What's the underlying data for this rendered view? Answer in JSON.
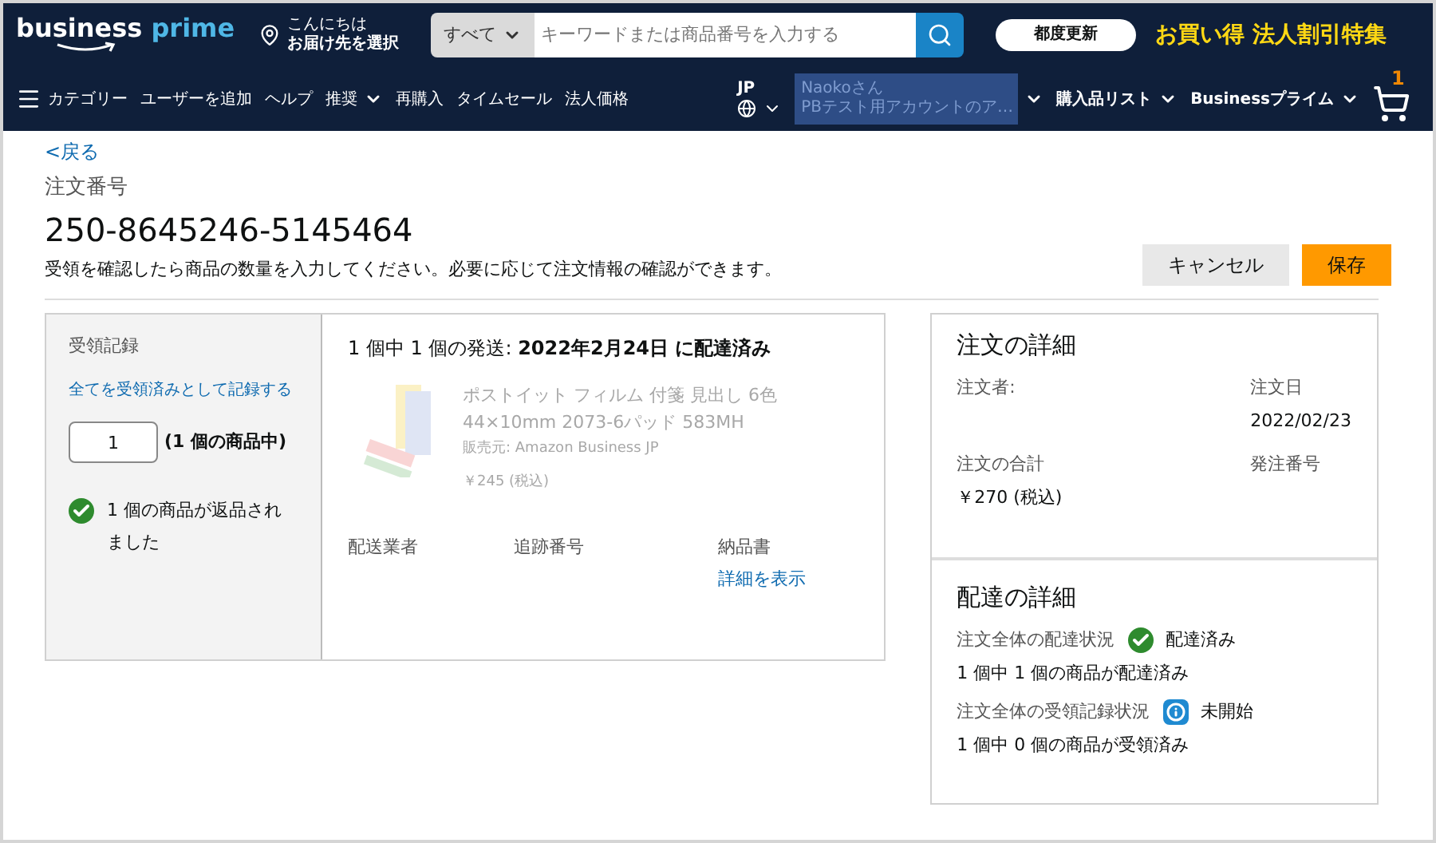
{
  "header": {
    "logo": {
      "word_1": "business",
      "word_2": "prime"
    },
    "location": {
      "greeting": "こんにちは",
      "label": "お届け先を選択"
    },
    "search": {
      "category": "すべて",
      "placeholder": "キーワードまたは商品番号を入力する"
    },
    "promo_button": "都度更新",
    "promo_text": "お買い得 法人割引特集"
  },
  "nav": {
    "items": [
      {
        "label": "カテゴリー",
        "kind": "menu"
      },
      {
        "label": "ユーザーを追加",
        "kind": "plain"
      },
      {
        "label": "ヘルプ",
        "kind": "plain"
      },
      {
        "label": "推奨",
        "kind": "dropdown"
      },
      {
        "label": "再購入",
        "kind": "plain"
      },
      {
        "label": "タイムセール",
        "kind": "plain"
      },
      {
        "label": "法人価格",
        "kind": "plain"
      }
    ],
    "language": "JP",
    "account": {
      "line_1": "Naokoさん",
      "line_2": "PBテスト用アカウントのア…"
    },
    "right_items": [
      {
        "label": "購入品リスト"
      },
      {
        "label": "Businessプライム"
      }
    ],
    "cart_count": "1"
  },
  "back_link": "<戻る",
  "order_label": "注文番号",
  "order_number": "250-8645246-5145464",
  "instruction": "受領を確認したら商品の数量を入力してください。必要に応じて注文情報の確認ができます。",
  "buttons": [
    {
      "label": "キャンセル",
      "kind": "secondary"
    },
    {
      "label": "保存",
      "kind": "primary"
    }
  ],
  "receipt": {
    "title": "受領記録",
    "record_all_link": "全てを受領済みとして記録する",
    "quantity": "1",
    "quantity_note": "(1 個の商品中)",
    "status": "1 個の商品が返品されました"
  },
  "shipment": {
    "title": "1 個中 1 個の発送: **2022年2月24日 に配達済み**",
    "product": {
      "name": "ポストイット フィルム 付箋 見出し 6色 44×10mm 2073-6パッド 583MH",
      "seller": "販売元: Amazon Business JP",
      "price": "￥245 (税込)"
    },
    "columns": [
      {
        "label": "配送業者"
      },
      {
        "label": "追跡番号"
      },
      {
        "label": "納品書",
        "link": "詳細を表示"
      }
    ]
  },
  "order_details": {
    "title": "注文の詳細",
    "fields": [
      {
        "label": "注文者:"
      },
      {
        "label": "注文日",
        "value": "2022/02/23"
      },
      {
        "label": "注文の合計",
        "value": "￥270 (税込)"
      },
      {
        "label": "発注番号"
      }
    ]
  },
  "delivery_details": {
    "title": "配達の詳細",
    "statuses": [
      {
        "label": "注文全体の配達状況",
        "kind": "done",
        "status": "配達済み",
        "summary": "1 個中 1 個の商品が配達済み"
      },
      {
        "label": "注文全体の受領記録状況",
        "kind": "info",
        "status": "未開始",
        "summary": "1 個中 0 個の商品が受領済み"
      }
    ]
  }
}
